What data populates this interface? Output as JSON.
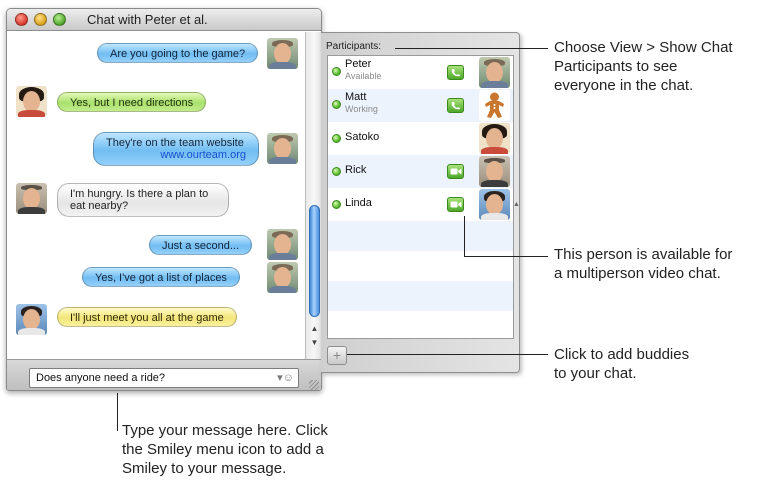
{
  "chat_window": {
    "title": "Chat with Peter et al.",
    "messages": [
      {
        "text": "Are you going to the game?",
        "color": "blue",
        "side": "right",
        "avatar": "peter-avatar"
      },
      {
        "text": "Yes, but I need directions",
        "color": "green",
        "side": "left",
        "avatar": "satoko-avatar"
      },
      {
        "text": "They're on the team website",
        "link": "www.ourteam.org",
        "color": "blue",
        "side": "right",
        "avatar": "peter-avatar"
      },
      {
        "text": "I'm hungry. Is there a plan to eat nearby?",
        "color": "gray",
        "side": "left",
        "avatar": "rick-avatar"
      },
      {
        "text": "Just a second...",
        "color": "blue",
        "side": "right",
        "avatar": "peter-avatar"
      },
      {
        "text": "Yes, I've got a list of places",
        "color": "blue",
        "side": "right",
        "avatar": "peter-avatar"
      },
      {
        "text": "I'll just meet you all at the game",
        "color": "yellow",
        "side": "left",
        "avatar": "linda-avatar"
      }
    ],
    "input_value": "Does anyone need a ride?"
  },
  "participants_drawer": {
    "header": "Participants:",
    "people": [
      {
        "name": "Peter",
        "status": "Available",
        "capability": "audio-chat-icon",
        "avatar": "peter-avatar"
      },
      {
        "name": "Matt",
        "status": "Working",
        "capability": "audio-chat-icon",
        "avatar": "gingerbread-avatar"
      },
      {
        "name": "Satoko",
        "status": "",
        "capability": "",
        "avatar": "satoko-avatar"
      },
      {
        "name": "Rick",
        "status": "",
        "capability": "video-chat-icon",
        "avatar": "rick-avatar"
      },
      {
        "name": "Linda",
        "status": "",
        "capability": "video-chat-icon",
        "avatar": "linda-avatar"
      }
    ],
    "add_button": "+"
  },
  "callouts": {
    "participants": [
      "Choose View > Show Chat",
      "Participants to see",
      "everyone in the chat."
    ],
    "video": [
      "This person is available for",
      "a multiperson video chat."
    ],
    "add": [
      "Click to add buddies",
      "to your chat."
    ],
    "type": [
      "Type your message here. Click",
      "the Smiley menu icon to add a",
      "Smiley to your message."
    ]
  },
  "colors": {
    "bubble_blue": "#71bdf2",
    "bubble_green": "#a9e06b",
    "bubble_yellow": "#f3e57a",
    "status_available": "#54b52a",
    "scroll_thumb": "#3f87d6"
  }
}
